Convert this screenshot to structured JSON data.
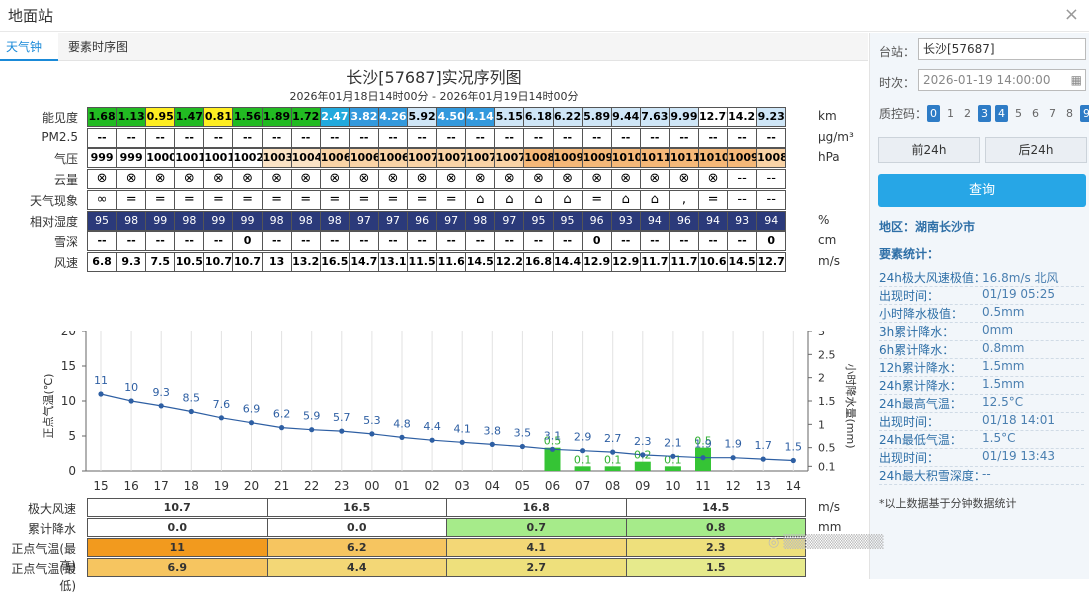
{
  "window": {
    "title": "地面站",
    "close": "×"
  },
  "tabs": [
    {
      "label": "天气钟"
    },
    {
      "label": "要素时序图"
    }
  ],
  "chart_title": "长沙[57687]实况序列图",
  "chart_subtitle": "2026年01月18日14时00分 - 2026年01月19日14时00分",
  "rows": {
    "visibility": {
      "label": "能见度",
      "unit": "km",
      "values": [
        "1.68",
        "1.13",
        "0.95",
        "1.47",
        "0.81",
        "1.56",
        "1.89",
        "1.72",
        "2.47",
        "3.82",
        "4.26",
        "5.92",
        "4.50",
        "4.14",
        "5.15",
        "6.18",
        "6.22",
        "5.89",
        "9.44",
        "7.63",
        "9.99",
        "12.77",
        "14.22",
        "9.23"
      ],
      "colors": [
        "#22bb22",
        "#22bb22",
        "#ffee22",
        "#22bb22",
        "#ffee22",
        "#22bb22",
        "#22bb22",
        "#22bb22",
        "#22aadd",
        "#3399dd",
        "#3399dd",
        "#cfe6f7",
        "#3399dd",
        "#3399dd",
        "#cfe6f7",
        "#cfe6f7",
        "#cfe6f7",
        "#cfe6f7",
        "#cfe6f7",
        "#cfe6f7",
        "#cfe6f7",
        "#ffffff",
        "#ffffff",
        "#cfe6f7"
      ]
    },
    "pm25": {
      "label": "PM2.5",
      "unit": "μg/m³",
      "values": [
        "--",
        "--",
        "--",
        "--",
        "--",
        "--",
        "--",
        "--",
        "--",
        "--",
        "--",
        "--",
        "--",
        "--",
        "--",
        "--",
        "--",
        "--",
        "--",
        "--",
        "--",
        "--",
        "--",
        "--"
      ]
    },
    "pressure": {
      "label": "气压",
      "unit": "hPa",
      "values": [
        "999",
        "999",
        "1000",
        "1001",
        "1001",
        "1002",
        "1003",
        "1004",
        "1006",
        "1006",
        "1006",
        "1007",
        "1007",
        "1007",
        "1007",
        "1008",
        "1009",
        "1009",
        "1010",
        "1011",
        "1011",
        "1010",
        "1009",
        "1008"
      ],
      "colors": [
        "#ffffff",
        "#ffffff",
        "#ffffff",
        "#ffffff",
        "#ffffff",
        "#ffffff",
        "#fbe3c5",
        "#fbe3c5",
        "#f9d3a6",
        "#f9d3a6",
        "#f9d3a6",
        "#f9d3a6",
        "#f9d3a6",
        "#f9d3a6",
        "#f9d3a6",
        "#f5b878",
        "#f5b878",
        "#f5b878",
        "#f5b878",
        "#f5b878",
        "#f5b878",
        "#f5b878",
        "#f5b878",
        "#f9d3a6"
      ]
    },
    "cloud": {
      "label": "云量",
      "unit": "",
      "values": [
        "⊗",
        "⊗",
        "⊗",
        "⊗",
        "⊗",
        "⊗",
        "⊗",
        "⊗",
        "⊗",
        "⊗",
        "⊗",
        "⊗",
        "⊗",
        "⊗",
        "⊗",
        "⊗",
        "⊗",
        "⊗",
        "⊗",
        "⊗",
        "⊗",
        "⊗",
        "--",
        "--"
      ]
    },
    "weather": {
      "label": "天气现象",
      "unit": "",
      "values": [
        "∞",
        "=",
        "=",
        "=",
        "=",
        "=",
        "=",
        "=",
        "=",
        "=",
        "=",
        "=",
        "=",
        "⌂",
        "⌂",
        "⌂",
        "⌂",
        "=",
        "⌂",
        "⌂",
        ",",
        "=",
        "--",
        "--"
      ]
    },
    "humidity": {
      "label": "相对湿度",
      "unit": "%",
      "values": [
        "95",
        "98",
        "99",
        "98",
        "99",
        "99",
        "98",
        "98",
        "98",
        "97",
        "97",
        "96",
        "97",
        "98",
        "97",
        "95",
        "95",
        "96",
        "93",
        "94",
        "96",
        "94",
        "93",
        "94"
      ]
    },
    "snow": {
      "label": "雪深",
      "unit": "cm",
      "values": [
        "--",
        "--",
        "--",
        "--",
        "--",
        "0",
        "--",
        "--",
        "--",
        "--",
        "--",
        "--",
        "--",
        "--",
        "--",
        "--",
        "--",
        "0",
        "--",
        "--",
        "--",
        "--",
        "--",
        "0"
      ]
    },
    "wind": {
      "label": "风速",
      "unit": "m/s",
      "values": [
        "6.8",
        "9.3",
        "7.5",
        "10.5",
        "10.7",
        "10.7",
        "13",
        "13.2",
        "16.5",
        "14.7",
        "13.1",
        "11.5",
        "11.6",
        "14.5",
        "12.2",
        "16.8",
        "14.4",
        "12.9",
        "12.9",
        "11.7",
        "11.7",
        "10.6",
        "14.5",
        "12.7"
      ]
    }
  },
  "chart_data": {
    "type": "line",
    "x": [
      "15",
      "16",
      "17",
      "18",
      "19",
      "20",
      "21",
      "22",
      "23",
      "00",
      "01",
      "02",
      "03",
      "04",
      "05",
      "06",
      "07",
      "08",
      "09",
      "10",
      "11",
      "12",
      "13",
      "14"
    ],
    "series": [
      {
        "values": [
          11,
          10,
          9.3,
          8.5,
          7.6,
          6.9,
          6.2,
          5.9,
          5.7,
          5.3,
          4.8,
          4.4,
          4.1,
          3.8,
          3.5,
          3.1,
          2.9,
          2.7,
          2.3,
          2.1,
          1.9,
          1.9,
          1.7,
          1.5
        ]
      },
      {
        "values": [
          0,
          0,
          0,
          0,
          0,
          0,
          0,
          0,
          0,
          0,
          0,
          0,
          0,
          0,
          0,
          0.5,
          0.1,
          0.1,
          0.2,
          0.1,
          0.5,
          0,
          0,
          0
        ]
      }
    ],
    "precip_labels": [
      "",
      "",
      "",
      "",
      "",
      "",
      "",
      "",
      "",
      "",
      "",
      "",
      "",
      "",
      "",
      "0.5",
      "0.1",
      "0.1",
      "0.2",
      "0.1",
      "0.5",
      "",
      "",
      ""
    ],
    "ylabel_left": "正点气温(℃)",
    "ylabel_right": "小时降水量(mm)",
    "yleft_ticks": [
      "0",
      "5",
      "10",
      "15",
      "20"
    ],
    "yleft_lim": [
      0,
      20
    ],
    "yright_ticks": [
      "0.1",
      "0.5",
      "1",
      "1.5",
      "2",
      "2.5",
      "3"
    ],
    "yright_lim": [
      0,
      3
    ],
    "line_color": "#2e5fa3",
    "bar_color": "#35c435"
  },
  "summary": {
    "rows": [
      {
        "label": "极大风速",
        "unit": "m/s",
        "values": [
          "10.7",
          "16.5",
          "16.8",
          "14.5"
        ],
        "colors": [
          "#ffffff",
          "#ffffff",
          "#ffffff",
          "#ffffff"
        ]
      },
      {
        "label": "累计降水",
        "unit": "mm",
        "values": [
          "0.0",
          "0.0",
          "0.7",
          "0.8"
        ],
        "colors": [
          "#ffffff",
          "#ffffff",
          "#a6eb8a",
          "#a6eb8a"
        ]
      },
      {
        "label": "正点气温(最高)",
        "unit": "",
        "values": [
          "11",
          "6.2",
          "4.1",
          "2.3"
        ],
        "colors": [
          "#f29a1e",
          "#f6c560",
          "#f3d776",
          "#eee07c"
        ]
      },
      {
        "label": "正点气温(最低)",
        "unit": "",
        "values": [
          "6.9",
          "4.4",
          "2.7",
          "1.5"
        ],
        "colors": [
          "#f6c560",
          "#f3d776",
          "#eee07c",
          "#e6ea8c"
        ]
      }
    ]
  },
  "sidebar": {
    "station_label": "台站：",
    "station_value": "长沙[57687]",
    "time_label": "时次：",
    "time_value": "2026-01-19 14:00:00",
    "qc_label": "质控码：",
    "qc_codes": [
      "0",
      "1",
      "2",
      "3",
      "4",
      "5",
      "6",
      "7",
      "8",
      "9"
    ],
    "qc_active": [
      0,
      3,
      4,
      9
    ],
    "prev_btn": "前24h",
    "next_btn": "后24h",
    "query_btn": "查询",
    "region": "地区：湖南长沙市",
    "stats_title": "要素统计：",
    "stats": [
      {
        "k": "24h极大风速极值：",
        "v": "16.8m/s 北风"
      },
      {
        "k": "出现时间：",
        "v": "01/19 05:25"
      },
      {
        "k": "小时降水极值：",
        "v": "0.5mm"
      },
      {
        "k": "3h累计降水：",
        "v": "0mm"
      },
      {
        "k": "6h累计降水：",
        "v": "0.8mm"
      },
      {
        "k": "12h累计降水：",
        "v": "1.5mm"
      },
      {
        "k": "24h累计降水：",
        "v": "1.5mm"
      },
      {
        "k": "24h最高气温：",
        "v": "12.5°C"
      },
      {
        "k": "出现时间：",
        "v": "01/18 14:01"
      },
      {
        "k": "24h最低气温：",
        "v": "1.5°C"
      },
      {
        "k": "出现时间：",
        "v": "01/19 13:43"
      },
      {
        "k": "24h最大积雪深度：",
        "v": "--"
      }
    ],
    "note": "*以上数据基于分钟数据统计"
  }
}
